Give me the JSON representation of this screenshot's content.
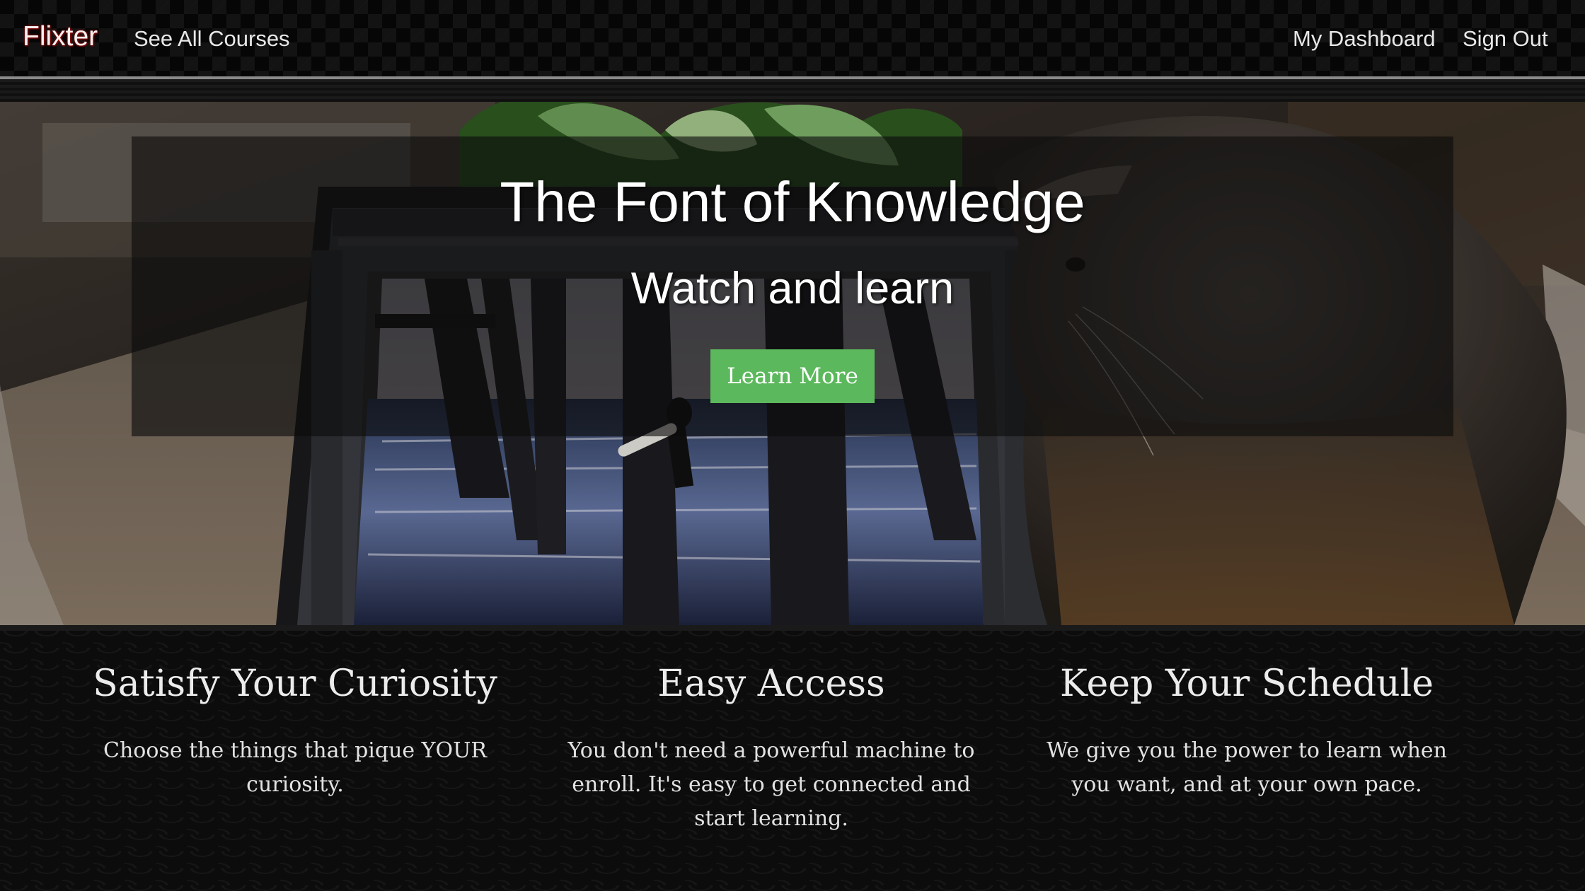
{
  "navbar": {
    "brand": "Flixter",
    "see_all_courses": "See All Courses",
    "my_dashboard": "My Dashboard",
    "sign_out": "Sign Out"
  },
  "hero": {
    "title": "The Font of Knowledge",
    "subtitle": "Watch and learn",
    "button_label": "Learn More"
  },
  "features": [
    {
      "heading": "Satisfy Your Curiosity",
      "text": "Choose the things that pique YOUR curiosity."
    },
    {
      "heading": "Easy Access",
      "text": "You don't need a powerful machine to enroll. It's easy to get connected and start learning."
    },
    {
      "heading": "Keep Your Schedule",
      "text": "We give you the power to learn when you want, and at your own pace."
    }
  ],
  "colors": {
    "brand_glow": "#b01010",
    "cta_green": "#5cb85c"
  }
}
